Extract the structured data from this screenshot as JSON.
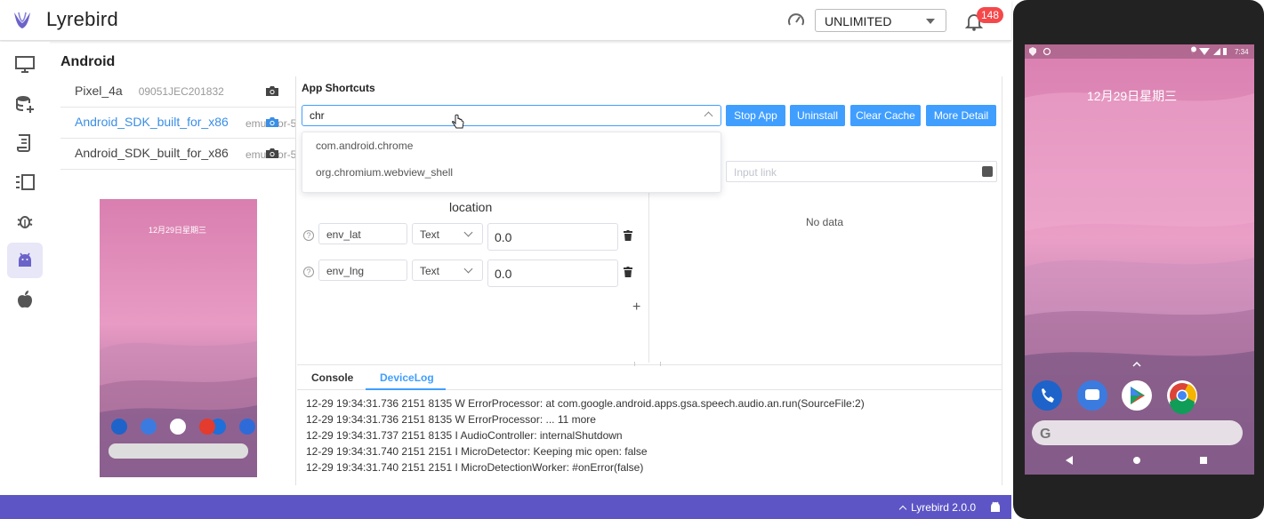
{
  "app": {
    "brand": "Lyrebird",
    "version": "Lyrebird 2.0.0",
    "accent": "#5d55c5"
  },
  "header": {
    "mode": "UNLIMITED",
    "notifications": "148"
  },
  "rail": {
    "items": [
      "monitor-icon",
      "database-add-icon",
      "document-icon",
      "checklist-icon",
      "bug-icon",
      "android-icon",
      "apple-icon"
    ],
    "active": "android-icon"
  },
  "page": {
    "title": "Android"
  },
  "devices": [
    {
      "name": "Pixel_4a",
      "serial": "09051JEC201832"
    },
    {
      "name": "Android_SDK_built_for_x86",
      "serial": "emulator-5"
    },
    {
      "name": "Android_SDK_built_for_x86",
      "serial": "emulator-5"
    }
  ],
  "app_shortcuts": {
    "heading": "App Shortcuts",
    "search_value": "chr",
    "options": [
      "com.android.chrome",
      "org.chromium.webview_shell"
    ],
    "buttons": {
      "stop": "Stop App",
      "uninstall": "Uninstall",
      "clear": "Clear Cache",
      "detail": "More Detail"
    }
  },
  "link": {
    "placeholder": "Input link"
  },
  "right_panel": {
    "empty": "No data"
  },
  "location": {
    "title": "location",
    "rows": [
      {
        "key": "env_lat",
        "type": "Text",
        "value": "0.0"
      },
      {
        "key": "env_lng",
        "type": "Text",
        "value": "0.0"
      }
    ]
  },
  "console": {
    "tabs": [
      "Console",
      "DeviceLog"
    ],
    "active_tab": "DeviceLog",
    "lines": [
      "12-29 19:34:31.736 2151 8135 W ErrorProcessor: at com.google.android.apps.gsa.speech.audio.an.run(SourceFile:2)",
      "12-29 19:34:31.736 2151 8135 W ErrorProcessor: ... 11 more",
      "12-29 19:34:31.737 2151 8135 I AudioController: internalShutdown",
      "12-29 19:34:31.740 2151 2151 I MicroDetector: Keeping mic open: false",
      "12-29 19:34:31.740 2151 2151 I MicroDetectionWorker: #onError(false)"
    ]
  },
  "phone": {
    "time": "7:34",
    "date": "12月29日星期三"
  }
}
